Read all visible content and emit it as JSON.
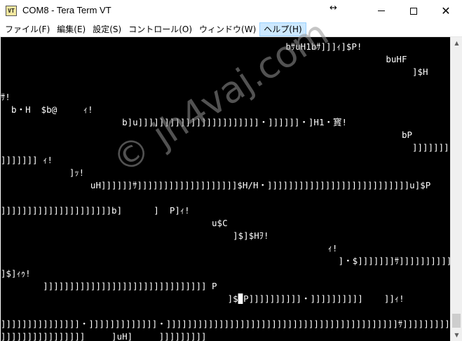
{
  "window": {
    "app_icon_text": "VT",
    "title": "COM8 - Tera Term VT",
    "resize_glyph": "↔",
    "close_glyph": "✕"
  },
  "menu": {
    "items": [
      {
        "label": "ファイル(F)",
        "active": false
      },
      {
        "label": "編集(E)",
        "active": false
      },
      {
        "label": "設定(S)",
        "active": false
      },
      {
        "label": "コントロール(O)",
        "active": false
      },
      {
        "label": "ウィンドウ(W)",
        "active": false
      },
      {
        "label": "ヘルプ(H)",
        "active": true
      }
    ]
  },
  "terminal": {
    "lines": [
      "                                                      bｻuH1bｻ]]]ｨ]$P!",
      "                                                                         buHF",
      "                                                                              ]$H         $bｨ｡bｨ!",
      "                                                                                                    b",
      "ｻ!",
      "  b・H  $b@     ｨ!",
      "                       b]u]]]]]]]]]]]]]]]]]]]]]]]・]]]]]]・]H1・寳!",
      "                                                                            bP",
      "                                                                              ]]]]]]]・]]]]]]]]]]]]",
      "]]]]]]] ｨ!",
      "             ]ｯ!",
      "                 uH]]]]]]ｻ]]]]]]]]]]]]]]]]]]]$H/H・]]]]]]]]]]]]]]]]]]]]]]]]]]]u]$P",
      "                                                                                                b▉]]]",
      "]]]]]]]]]]]]]]]]]]]]]b]      ]  P]ｨ!",
      "                                        u$C",
      "                                            ]$]$Hｦ!",
      "                                                              ｨ!",
      "                                                                ]・$]]]]]]]ｻ]]]]]]]]]]]]]]]]]]",
      "]$]ｨｩ!",
      "        ]]]]]]]]]]]]]]]]]]]]]]]]]]]]]]] P",
      "                                           ]$▉P]]]]]]]]]]・]]]]]]]]]]    ]]ｨ!",
      "                                                                                        ]$$]]]]]]]]]]",
      "]]]]]]]]]]]]]]]・]]]]]]]]]]]]]・]]]]]]]]]]]]]]]]]]]]]]]]]]]]]]]]]]]]]]]]]]]]ｻ]]]]]]]]]]]]]]]]]]",
      "]]]]]]]]]]]]]]]]     ]uH]     ]]]]]]]]]"
    ]
  },
  "watermark": {
    "text": "© jh4vaj.com"
  },
  "scrollbar": {
    "up_arrow": "▲",
    "down_arrow": "▼"
  }
}
